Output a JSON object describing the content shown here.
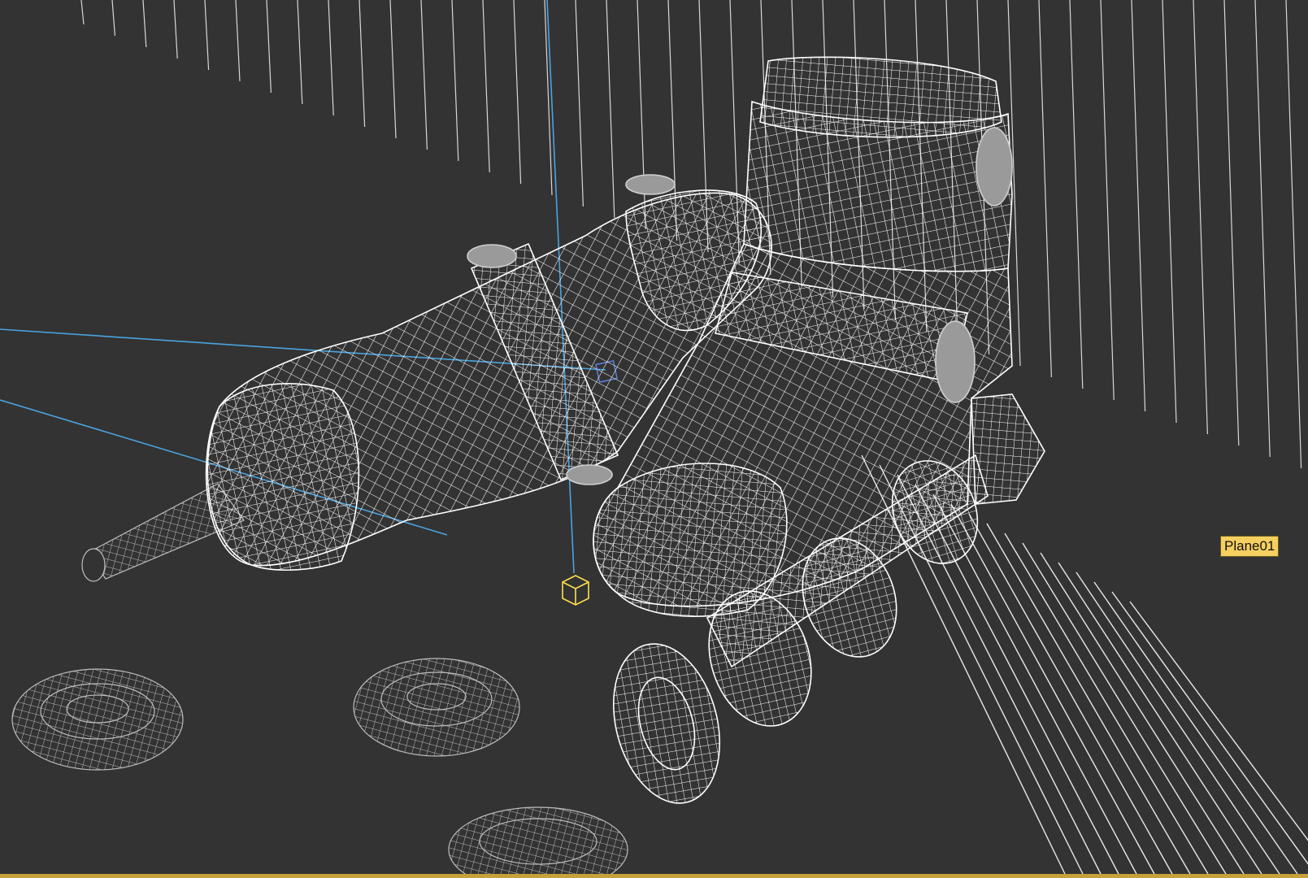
{
  "viewport": {
    "background": "#333333",
    "wire_color": "#ffffff",
    "dim_wire_color": "#bdbdbd",
    "axis_color": "#4aa3df",
    "gizmo_color": "#ffe14d",
    "border_color": "#c8a03a"
  },
  "tooltip": {
    "label": "Plane01"
  }
}
